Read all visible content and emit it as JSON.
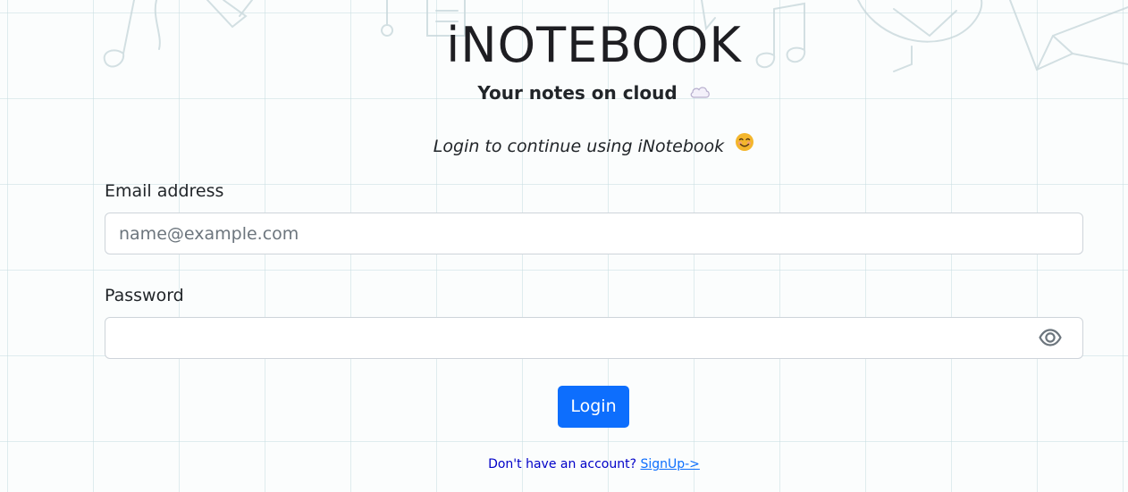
{
  "header": {
    "title": "iNOTEBOOK",
    "tagline": "Your notes on cloud"
  },
  "login": {
    "subtitle": "Login to continue using iNotebook",
    "email_label": "Email address",
    "email_placeholder": "name@example.com",
    "email_value": "",
    "password_label": "Password",
    "password_value": "",
    "submit_label": "Login"
  },
  "footer": {
    "prompt": "Don't have an account?",
    "signup_link": "SignUp->"
  },
  "icons": {
    "tagline_icon": "cloud-icon",
    "subtitle_icon": "smiling-face-icon",
    "password_toggle_icon": "eye-icon"
  },
  "colors": {
    "primary": "#0d6efd",
    "footer_text": "#0000c8",
    "input_border": "#ced4da",
    "emoji_face": "#f4b62c"
  }
}
